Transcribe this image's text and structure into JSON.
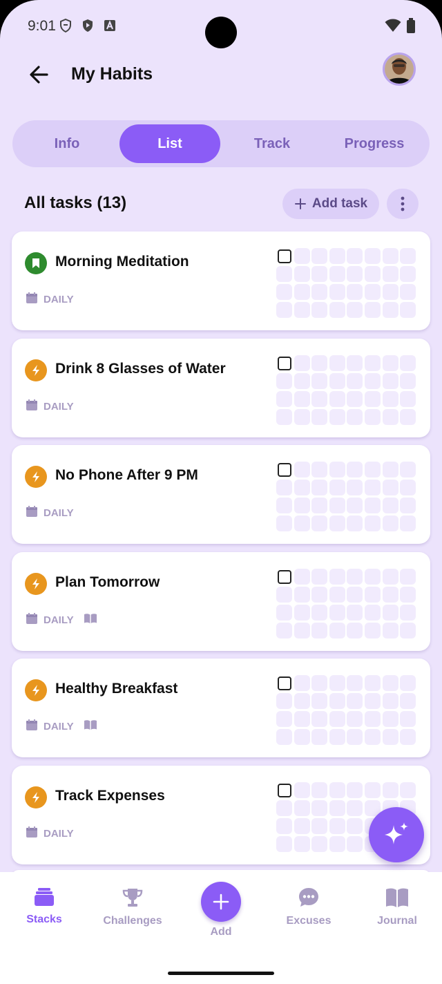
{
  "status_bar": {
    "time": "9:01"
  },
  "app_bar": {
    "title": "My Habits"
  },
  "tabs": [
    {
      "label": "Info",
      "active": false
    },
    {
      "label": "List",
      "active": true
    },
    {
      "label": "Track",
      "active": false
    },
    {
      "label": "Progress",
      "active": false
    }
  ],
  "section": {
    "title": "All tasks (13)",
    "add_task_label": "Add task"
  },
  "tasks": [
    {
      "title": "Morning Meditation",
      "frequency": "DAILY",
      "icon": "bookmark-icon",
      "icon_color": "#2E8B2E",
      "has_journal": false
    },
    {
      "title": "Drink 8 Glasses of Water",
      "frequency": "DAILY",
      "icon": "lightning-icon",
      "icon_color": "#E8961E",
      "has_journal": false
    },
    {
      "title": "No Phone After 9 PM",
      "frequency": "DAILY",
      "icon": "lightning-icon",
      "icon_color": "#E8961E",
      "has_journal": false
    },
    {
      "title": "Plan Tomorrow",
      "frequency": "DAILY",
      "icon": "lightning-icon",
      "icon_color": "#E8961E",
      "has_journal": true
    },
    {
      "title": "Healthy Breakfast",
      "frequency": "DAILY",
      "icon": "lightning-icon",
      "icon_color": "#E8961E",
      "has_journal": true
    },
    {
      "title": "Track Expenses",
      "frequency": "DAILY",
      "icon": "lightning-icon",
      "icon_color": "#E8961E",
      "has_journal": false
    }
  ],
  "bottom_nav": {
    "items": [
      {
        "label": "Stacks",
        "icon": "stacks-icon",
        "active": true
      },
      {
        "label": "Challenges",
        "icon": "trophy-icon",
        "active": false
      },
      {
        "label": "Add",
        "icon": "plus-icon",
        "active": false
      },
      {
        "label": "Excuses",
        "icon": "chat-bubble-icon",
        "active": false
      },
      {
        "label": "Journal",
        "icon": "book-icon",
        "active": false
      }
    ]
  },
  "colors": {
    "accent": "#8B5CF6",
    "background": "#ECE3FC",
    "muted": "#A89CC2"
  }
}
